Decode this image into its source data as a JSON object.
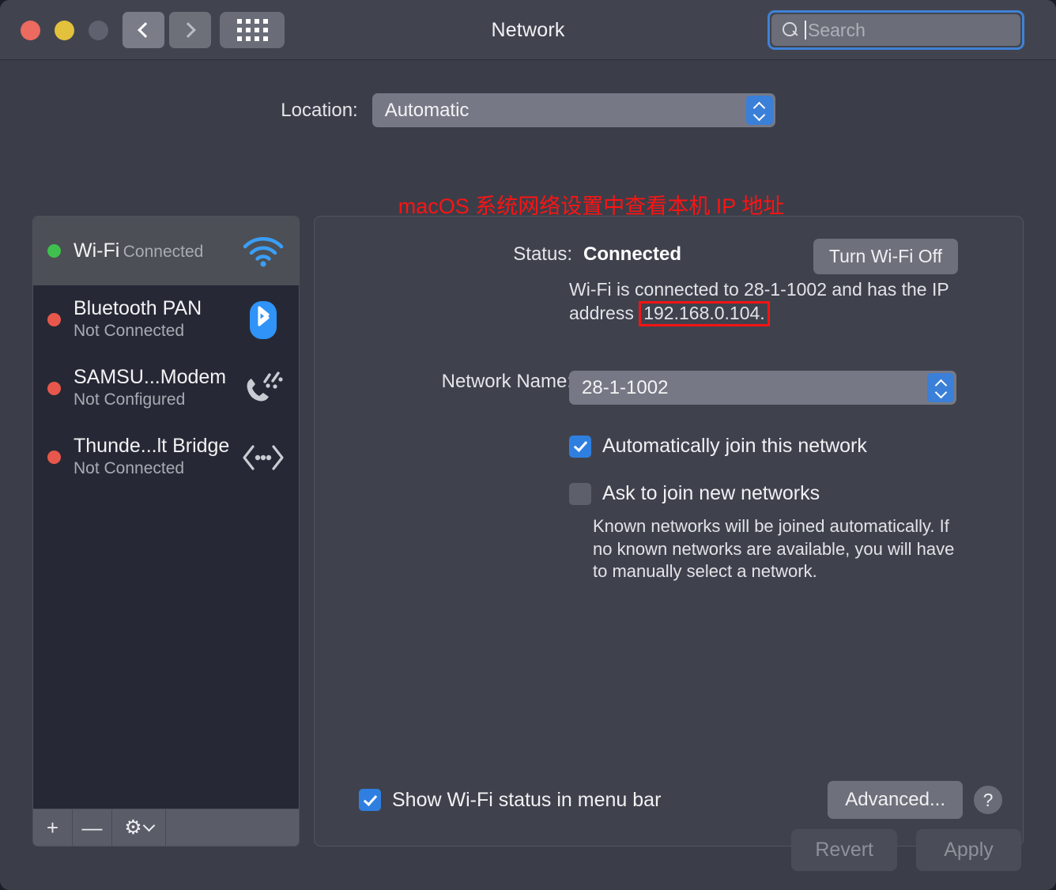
{
  "window": {
    "title": "Network",
    "traffic_lights": [
      "close",
      "minimize",
      "zoom-disabled"
    ]
  },
  "toolbar": {
    "back_icon": "chevron-left-icon",
    "forward_icon": "chevron-right-icon",
    "grid_icon": "show-all-grid-icon"
  },
  "search": {
    "placeholder": "Search",
    "value": "",
    "icon": "search-icon",
    "focused": true
  },
  "location": {
    "label": "Location:",
    "value": "Automatic"
  },
  "annotation": {
    "text": "macOS 系统网络设置中查看本机 IP 地址",
    "color": "#fb1414"
  },
  "sidebar": {
    "items": [
      {
        "name": "Wi-Fi",
        "status": "Connected",
        "dot": "green",
        "icon": "wifi-icon",
        "selected": true
      },
      {
        "name": "Bluetooth PAN",
        "status": "Not Connected",
        "dot": "red",
        "icon": "bluetooth-icon",
        "selected": false
      },
      {
        "name": "SAMSU...Modem",
        "status": "Not Configured",
        "dot": "red",
        "icon": "modem-phone-icon",
        "selected": false
      },
      {
        "name": "Thunde...lt Bridge",
        "status": "Not Connected",
        "dot": "red",
        "icon": "thunderbolt-bridge-icon",
        "selected": false
      }
    ],
    "toolbar": {
      "add_label": "+",
      "remove_label": "—",
      "gear_icon": "gear-icon",
      "gear_caret": "chevron-down-icon"
    }
  },
  "main": {
    "status_label": "Status:",
    "status_value": "Connected",
    "wifi_toggle_label": "Turn Wi-Fi Off",
    "description_prefix": "Wi-Fi is connected to 28-1-1002 and has the IP address ",
    "description_ip": "192.168.0.104.",
    "network_name_label": "Network Name:",
    "network_name_value": "28-1-1002",
    "checkbox_auto_join": {
      "label": "Automatically join this network",
      "checked": true
    },
    "checkbox_ask_join": {
      "label": "Ask to join new networks",
      "checked": false
    },
    "help_text": "Known networks will be joined automatically. If no known networks are available, you will have to manually select a network.",
    "checkbox_menu_bar": {
      "label": "Show Wi-Fi status in menu bar",
      "checked": true
    },
    "advanced_label": "Advanced...",
    "help_button_label": "?"
  },
  "footer": {
    "revert_label": "Revert",
    "apply_label": "Apply"
  },
  "colors": {
    "accent": "#2f7fe0",
    "annotation_red": "#fb1414",
    "status_connected_dot": "#3fc04e",
    "status_disconnected_dot": "#e8574c"
  }
}
